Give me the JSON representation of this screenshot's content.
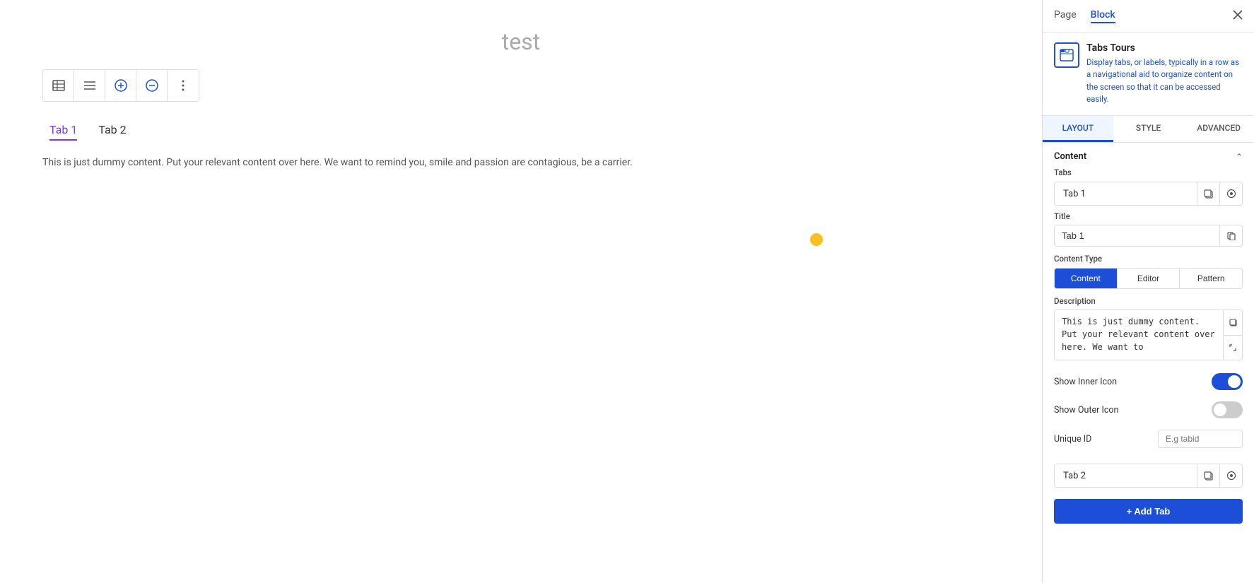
{
  "canvas": {
    "title": "test",
    "tab1_label": "Tab 1",
    "tab2_label": "Tab 2",
    "content_text": "This is just dummy content. Put your relevant content over here. We want to remind you, smile and passion are contagious, be a carrier."
  },
  "toolbar": {
    "btn1_icon": "☰",
    "btn2_icon": "≡",
    "btn3_icon": "⊕",
    "btn4_icon": "⊖",
    "btn5_icon": "⋮"
  },
  "panel": {
    "tab_page": "Page",
    "tab_block": "Block",
    "block_name": "Tabs Tours",
    "block_desc": "Display tabs, or labels, typically in a row as a navigational aid to organize content on the screen so that it can be accessed easily.",
    "layout_tab": "LAYOUT",
    "style_tab": "STYLE",
    "advanced_tab": "ADVANCED",
    "section_content": "Content",
    "tabs_label": "Tabs",
    "tab1_row_label": "Tab 1",
    "tab2_row_label": "Tab 2",
    "title_label": "Title",
    "title_value": "Tab 1",
    "content_type_label": "Content Type",
    "ct_content": "Content",
    "ct_editor": "Editor",
    "ct_pattern": "Pattern",
    "description_label": "Description",
    "description_value": "This is just dummy content. Put your relevant content over here. We want to",
    "show_inner_icon_label": "Show Inner Icon",
    "show_outer_icon_label": "Show Outer Icon",
    "unique_id_label": "Unique ID",
    "unique_id_placeholder": "E.g tabid",
    "add_tab_label": "+ Add Tab"
  }
}
